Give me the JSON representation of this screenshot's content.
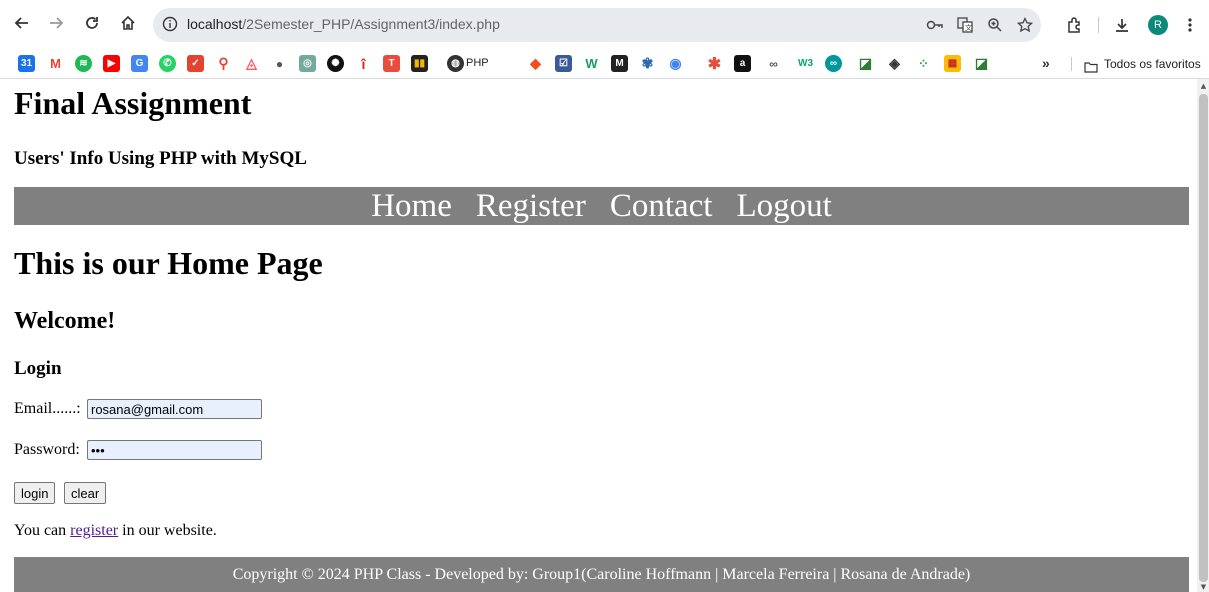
{
  "browser": {
    "url_host": "localhost",
    "url_path": "/2Semester_PHP/Assignment3/index.php",
    "profile_initial": "R",
    "bookmark_php_label": "PHP",
    "all_bookmarks_label": "Todos os favoritos",
    "overflow_label": "»"
  },
  "page": {
    "title": "Final Assignment",
    "subtitle": "Users' Info Using PHP with MySQL",
    "nav": [
      "Home",
      "Register",
      "Contact",
      "Logout"
    ],
    "heading": "This is our Home Page",
    "welcome": "Welcome!",
    "login_heading": "Login",
    "email_label": "Email......:",
    "email_value": "rosana@gmail.com",
    "password_label": "Password:",
    "password_value": "•••",
    "login_button": "login",
    "clear_button": "clear",
    "register_prefix": "You can ",
    "register_link": "register",
    "register_suffix": " in our website.",
    "footer": "Copyright © 2024 PHP Class - Developed by: Group1(Caroline Hoffmann | Marcela Ferreira | Rosana de Andrade)"
  },
  "colors": {
    "nav_bg": "#808080",
    "input_bg": "#e8f0fe",
    "link_visited": "#551a8b",
    "avatar": "#0b8a7a"
  },
  "icons": {
    "toolbar": [
      "back-arrow-icon",
      "forward-arrow-icon",
      "reload-icon",
      "home-icon",
      "site-info-icon",
      "password-key-icon",
      "translate-icon",
      "zoom-icon",
      "star-icon",
      "extensions-icon",
      "download-icon",
      "menu-dots-icon"
    ],
    "bookmarks": [
      "calendar-icon",
      "gmail-icon",
      "spotify-icon",
      "youtube-icon",
      "translate-bookmark-icon",
      "whatsapp-icon",
      "todoist-icon",
      "maps-icon",
      "airbnb-icon",
      "apple-icon",
      "chatgpt-icon",
      "openai-icon",
      "info-icon",
      "t-icon",
      "chart-icon",
      "globe-icon",
      "figma-icon",
      "checkbox-icon",
      "w-icon",
      "m-icon",
      "butterfly-icon",
      "google-lens-icon",
      "asterisk-icon",
      "a-icon",
      "link-icon",
      "w3schools-icon",
      "arduino-icon",
      "cube-icon",
      "layers-icon",
      "dots-icon",
      "grid-icon",
      "stack-icon",
      "folder-icon"
    ]
  }
}
